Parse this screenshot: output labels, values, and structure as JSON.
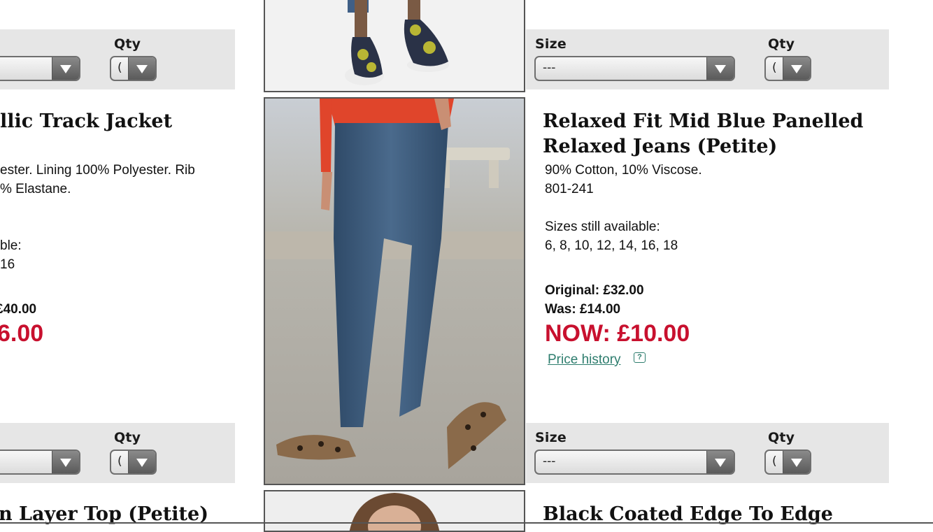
{
  "labels": {
    "size": "Size",
    "qty": "Qty"
  },
  "select_defaults": {
    "size": "---",
    "qty": "("
  },
  "left_column": {
    "product_1": {
      "title_partial": "llic Track Jacket",
      "desc_line1": "ester. Lining 100% Polyester. Rib",
      "desc_line2": "% Elastane.",
      "sizes_label_partial": "ble:",
      "sizes_partial": "16",
      "was_partial": "£40.00",
      "now_partial": "6.00"
    },
    "product_2": {
      "title_partial": "n Layer Top (Petite)"
    }
  },
  "right_column": {
    "product_1": {
      "title_line1": "Relaxed Fit Mid Blue Panelled",
      "title_line2": "Relaxed Jeans (Petite)",
      "description": "90% Cotton, 10% Viscose.",
      "code": "801-241",
      "sizes_label": "Sizes still available:",
      "sizes": "6, 8, 10, 12, 14, 16, 18",
      "original": "Original: £32.00",
      "was": "Was: £14.00",
      "now": "NOW: £10.00",
      "price_history": "Price history",
      "help_icon_glyph": "?"
    },
    "product_2": {
      "title_partial": "Black Coated Edge To Edge"
    }
  },
  "images": {
    "top": "shoes-photo",
    "middle": "jeans-photo",
    "bottom": "top-photo"
  },
  "colors": {
    "price_red": "#c8102e",
    "link_green": "#2e7d6e",
    "panel_grey": "#e6e6e6"
  }
}
